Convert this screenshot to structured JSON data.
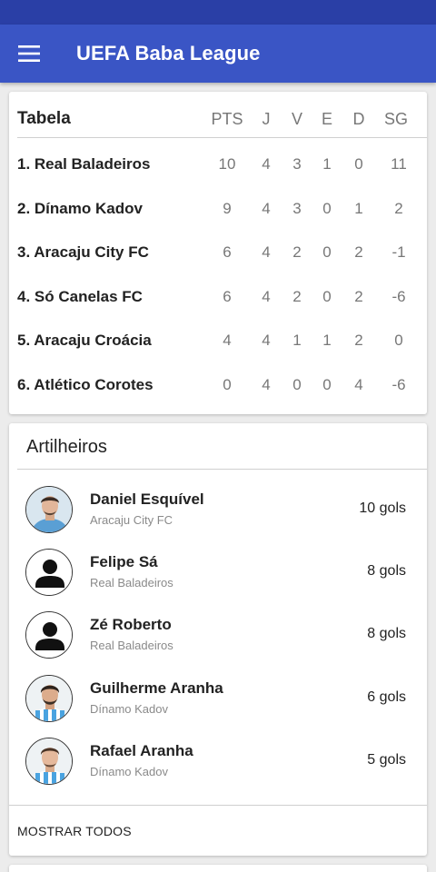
{
  "app": {
    "title": "UEFA Baba League",
    "accent_color": "#3a55c5",
    "statusbar_color": "#2a3fa6"
  },
  "standings": {
    "title": "Tabela",
    "columns": [
      "PTS",
      "J",
      "V",
      "E",
      "D",
      "SG"
    ],
    "rows": [
      {
        "team": "1. Real Baladeiros",
        "pts": "10",
        "j": "4",
        "v": "3",
        "e": "1",
        "d": "0",
        "sg": "11"
      },
      {
        "team": "2. Dínamo Kadov",
        "pts": "9",
        "j": "4",
        "v": "3",
        "e": "0",
        "d": "1",
        "sg": "2"
      },
      {
        "team": "3. Aracaju City FC",
        "pts": "6",
        "j": "4",
        "v": "2",
        "e": "0",
        "d": "2",
        "sg": "-1"
      },
      {
        "team": "4. Só Canelas FC",
        "pts": "6",
        "j": "4",
        "v": "2",
        "e": "0",
        "d": "2",
        "sg": "-6"
      },
      {
        "team": "5. Aracaju Croácia",
        "pts": "4",
        "j": "4",
        "v": "1",
        "e": "1",
        "d": "2",
        "sg": "0"
      },
      {
        "team": "6. Atlético Corotes",
        "pts": "0",
        "j": "4",
        "v": "0",
        "e": "0",
        "d": "4",
        "sg": "-6"
      }
    ]
  },
  "scorers": {
    "title": "Artilheiros",
    "players": [
      {
        "name": "Daniel Esquível",
        "team": "Aracaju City FC",
        "goals": "10 gols",
        "avatar": "photo"
      },
      {
        "name": "Felipe Sá",
        "team": "Real Baladeiros",
        "goals": "8 gols",
        "avatar": "person-icon"
      },
      {
        "name": "Zé Roberto",
        "team": "Real Baladeiros",
        "goals": "8 gols",
        "avatar": "person-icon"
      },
      {
        "name": "Guilherme Aranha",
        "team": "Dínamo Kadov",
        "goals": "6 gols",
        "avatar": "photo"
      },
      {
        "name": "Rafael Aranha",
        "team": "Dínamo Kadov",
        "goals": "5 gols",
        "avatar": "photo"
      }
    ],
    "show_all_label": "MOSTRAR TODOS"
  }
}
